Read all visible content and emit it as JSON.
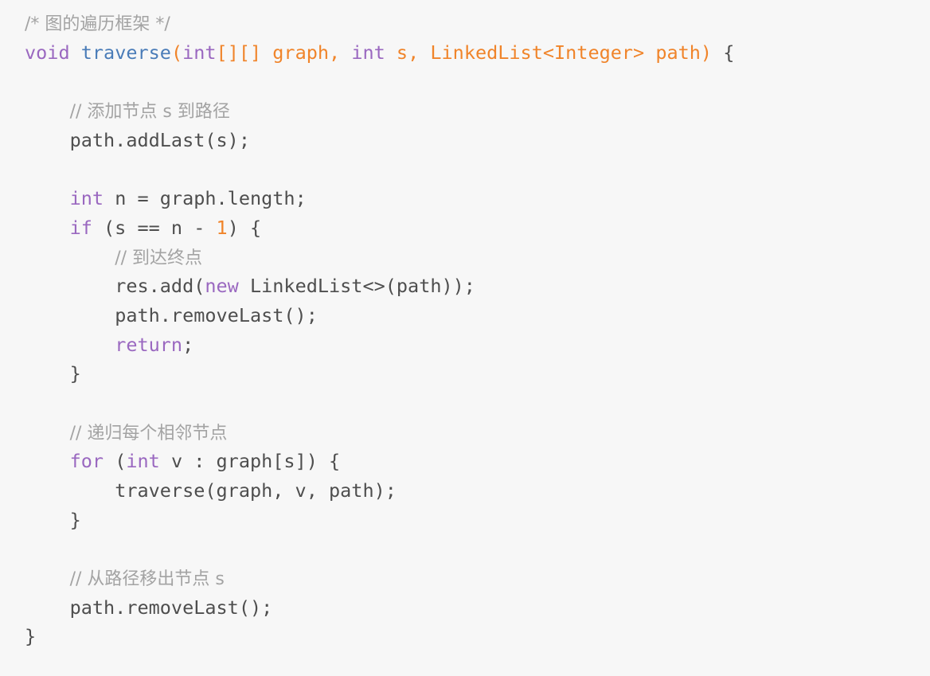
{
  "editor": {
    "language": "java",
    "background_color": "#f7f7f7",
    "theme_name": "light",
    "font_size_px": 23.5,
    "line_height_px": 36.7,
    "colors": {
      "comment": "#a3a3a3",
      "keyword": "#9a68c0",
      "function": "#4a7cb8",
      "parameter": "#f0842a",
      "number": "#f0842a",
      "default": "#4e4e4e",
      "background": "#f7f7f7"
    }
  },
  "code": {
    "lines": [
      {
        "number": 1,
        "indent": 0,
        "text": "/* 图的遍历框架 */",
        "tokens": [
          {
            "t": "/* 图的遍历框架 */",
            "c": "com"
          }
        ]
      },
      {
        "number": 2,
        "indent": 0,
        "text": "void traverse(int[][] graph, int s, LinkedList<Integer> path) {",
        "tokens": [
          {
            "t": "void",
            "c": "kw"
          },
          {
            "t": " ",
            "c": "def"
          },
          {
            "t": "traverse",
            "c": "fn"
          },
          {
            "t": "(",
            "c": "par"
          },
          {
            "t": "int",
            "c": "kw"
          },
          {
            "t": "[][] graph, ",
            "c": "par"
          },
          {
            "t": "int",
            "c": "kw"
          },
          {
            "t": " s, LinkedList<Integer> path)",
            "c": "par"
          },
          {
            "t": " {",
            "c": "def"
          }
        ]
      },
      {
        "number": 3,
        "indent": 0,
        "text": "",
        "tokens": []
      },
      {
        "number": 4,
        "indent": 4,
        "text": "// 添加节点 s 到路径",
        "tokens": [
          {
            "t": "// 添加节点 s 到路径",
            "c": "com"
          }
        ]
      },
      {
        "number": 5,
        "indent": 4,
        "text": "path.addLast(s);",
        "tokens": [
          {
            "t": "path.addLast(s);",
            "c": "def"
          }
        ]
      },
      {
        "number": 6,
        "indent": 0,
        "text": "",
        "tokens": []
      },
      {
        "number": 7,
        "indent": 4,
        "text": "int n = graph.length;",
        "tokens": [
          {
            "t": "int",
            "c": "kw"
          },
          {
            "t": " n = graph.length;",
            "c": "def"
          }
        ]
      },
      {
        "number": 8,
        "indent": 4,
        "text": "if (s == n - 1) {",
        "tokens": [
          {
            "t": "if",
            "c": "kw"
          },
          {
            "t": " (s == n - ",
            "c": "def"
          },
          {
            "t": "1",
            "c": "num"
          },
          {
            "t": ") {",
            "c": "def"
          }
        ]
      },
      {
        "number": 9,
        "indent": 8,
        "text": "// 到达终点",
        "tokens": [
          {
            "t": "// 到达终点",
            "c": "com"
          }
        ]
      },
      {
        "number": 10,
        "indent": 8,
        "text": "res.add(new LinkedList<>(path));",
        "tokens": [
          {
            "t": "res.add(",
            "c": "def"
          },
          {
            "t": "new",
            "c": "kw"
          },
          {
            "t": " LinkedList<>(path));",
            "c": "def"
          }
        ]
      },
      {
        "number": 11,
        "indent": 8,
        "text": "path.removeLast();",
        "tokens": [
          {
            "t": "path.removeLast();",
            "c": "def"
          }
        ]
      },
      {
        "number": 12,
        "indent": 8,
        "text": "return;",
        "tokens": [
          {
            "t": "return",
            "c": "kw"
          },
          {
            "t": ";",
            "c": "def"
          }
        ]
      },
      {
        "number": 13,
        "indent": 4,
        "text": "}",
        "tokens": [
          {
            "t": "}",
            "c": "def"
          }
        ]
      },
      {
        "number": 14,
        "indent": 0,
        "text": "",
        "tokens": []
      },
      {
        "number": 15,
        "indent": 4,
        "text": "// 递归每个相邻节点",
        "tokens": [
          {
            "t": "// 递归每个相邻节点",
            "c": "com"
          }
        ]
      },
      {
        "number": 16,
        "indent": 4,
        "text": "for (int v : graph[s]) {",
        "tokens": [
          {
            "t": "for",
            "c": "kw"
          },
          {
            "t": " (",
            "c": "def"
          },
          {
            "t": "int",
            "c": "kw"
          },
          {
            "t": " v : graph[s]) {",
            "c": "def"
          }
        ]
      },
      {
        "number": 17,
        "indent": 8,
        "text": "traverse(graph, v, path);",
        "tokens": [
          {
            "t": "traverse(graph, v, path);",
            "c": "def"
          }
        ]
      },
      {
        "number": 18,
        "indent": 4,
        "text": "}",
        "tokens": [
          {
            "t": "}",
            "c": "def"
          }
        ]
      },
      {
        "number": 19,
        "indent": 0,
        "text": "",
        "tokens": []
      },
      {
        "number": 20,
        "indent": 4,
        "text": "// 从路径移出节点 s",
        "tokens": [
          {
            "t": "// 从路径移出节点 s",
            "c": "com"
          }
        ]
      },
      {
        "number": 21,
        "indent": 4,
        "text": "path.removeLast();",
        "tokens": [
          {
            "t": "path.removeLast();",
            "c": "def"
          }
        ]
      },
      {
        "number": 22,
        "indent": 0,
        "text": "}",
        "tokens": [
          {
            "t": "}",
            "c": "def"
          }
        ]
      }
    ]
  }
}
